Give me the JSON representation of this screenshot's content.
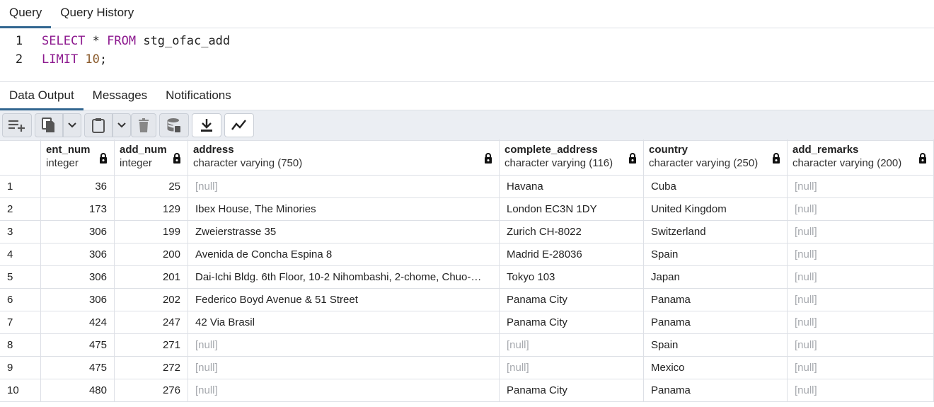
{
  "editor_tabs": [
    "Query",
    "Query History"
  ],
  "code": {
    "line_numbers": [
      "1",
      "2"
    ],
    "line1": {
      "kw1": "SELECT",
      "op": " * ",
      "kw2": "FROM",
      "ident": " stg_ofac_add"
    },
    "line2": {
      "kw": "LIMIT",
      "num": " 10",
      "punct": ";"
    }
  },
  "output_tabs": [
    "Data Output",
    "Messages",
    "Notifications"
  ],
  "toolbar_icons": [
    "add-row-icon",
    "copy-icon",
    "chevron-down-icon",
    "paste-icon",
    "chevron-down-icon",
    "delete-icon",
    "save-data-icon",
    "download-icon",
    "graph-icon"
  ],
  "columns": [
    {
      "name": "ent_num",
      "type": "integer"
    },
    {
      "name": "add_num",
      "type": "integer"
    },
    {
      "name": "address",
      "type": "character varying (750)"
    },
    {
      "name": "complete_address",
      "type": "character varying (116)"
    },
    {
      "name": "country",
      "type": "character varying (250)"
    },
    {
      "name": "add_remarks",
      "type": "character varying (200)"
    }
  ],
  "rows": [
    [
      "1",
      "36",
      "25",
      "[null]",
      "Havana",
      "Cuba",
      "[null]"
    ],
    [
      "2",
      "173",
      "129",
      "Ibex House, The Minories",
      "London EC3N 1DY",
      "United Kingdom",
      "[null]"
    ],
    [
      "3",
      "306",
      "199",
      "Zweierstrasse 35",
      "Zurich CH-8022",
      "Switzerland",
      "[null]"
    ],
    [
      "4",
      "306",
      "200",
      "Avenida de Concha Espina 8",
      "Madrid E-28036",
      "Spain",
      "[null]"
    ],
    [
      "5",
      "306",
      "201",
      "Dai-Ichi Bldg. 6th Floor, 10-2 Nihombashi, 2-chome, Chuo-…",
      "Tokyo 103",
      "Japan",
      "[null]"
    ],
    [
      "6",
      "306",
      "202",
      "Federico Boyd Avenue & 51 Street",
      "Panama City",
      "Panama",
      "[null]"
    ],
    [
      "7",
      "424",
      "247",
      "42 Via Brasil",
      "Panama City",
      "Panama",
      "[null]"
    ],
    [
      "8",
      "475",
      "271",
      "[null]",
      "[null]",
      "Spain",
      "[null]"
    ],
    [
      "9",
      "475",
      "272",
      "[null]",
      "[null]",
      "Mexico",
      "[null]"
    ],
    [
      "10",
      "480",
      "276",
      "[null]",
      "Panama City",
      "Panama",
      "[null]"
    ]
  ],
  "colors": {
    "active_tab_underline": "#326690",
    "keyword": "#8d1a8f",
    "number": "#8a5a2b",
    "null_text": "#a6a9ae",
    "toolbar_bg": "#ebeef3"
  }
}
